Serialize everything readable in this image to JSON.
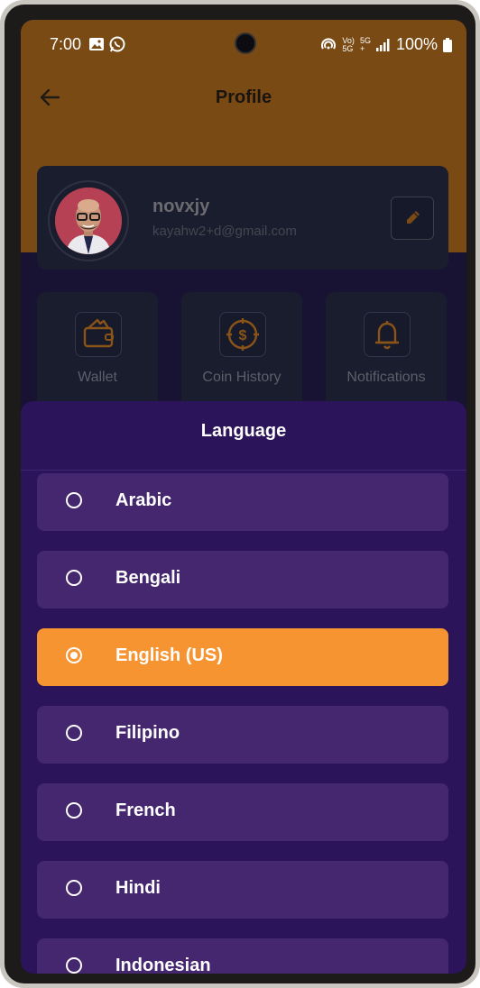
{
  "status_bar": {
    "time": "7:00",
    "network_top": "Vo)",
    "network_bottom": "5G",
    "network2_top": "5G",
    "network2_bottom": "+",
    "battery": "100%"
  },
  "appbar": {
    "title": "Profile"
  },
  "profile": {
    "name": "novxjy",
    "email": "kayahw2+d@gmail.com"
  },
  "tiles": [
    {
      "label": "Wallet",
      "icon": "wallet-icon"
    },
    {
      "label": "Coin History",
      "icon": "coin-icon"
    },
    {
      "label": "Notifications",
      "icon": "bell-icon"
    }
  ],
  "sheet": {
    "title": "Language",
    "languages": [
      "Arabic",
      "Bengali",
      "English (US)",
      "Filipino",
      "French",
      "Hindi",
      "Indonesian"
    ],
    "selected": "English (US)"
  },
  "colors": {
    "header": "#7a4a14",
    "sheet": "#2b1459",
    "item": "#44276f",
    "selected": "#f59431"
  }
}
